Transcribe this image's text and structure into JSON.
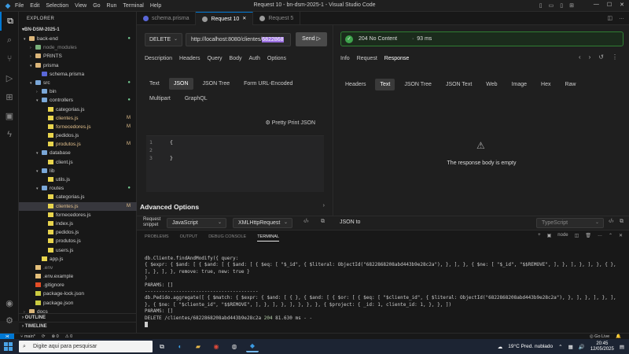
{
  "titlebar": {
    "menu": [
      "File",
      "Edit",
      "Selection",
      "View",
      "Go",
      "Run",
      "Terminal",
      "Help"
    ],
    "title": "Request 10 - bn-dsm-2025-1 - Visual Studio Code"
  },
  "sidebar": {
    "header": "EXPLORER",
    "root": "BN-DSM-2025-1",
    "tree": [
      {
        "label": "back-end",
        "kind": "folder",
        "level": 0,
        "open": true,
        "badge": "dot"
      },
      {
        "label": "node_modules",
        "kind": "folder",
        "level": 1,
        "open": false,
        "muted": true
      },
      {
        "label": "PRINTS",
        "kind": "folder",
        "level": 1,
        "open": false
      },
      {
        "label": "prisma",
        "kind": "folder",
        "level": 1,
        "open": true
      },
      {
        "label": "schema.prisma",
        "kind": "prisma",
        "level": 2
      },
      {
        "label": "src",
        "kind": "folder",
        "level": 1,
        "open": true,
        "badge": "dot"
      },
      {
        "label": "bin",
        "kind": "folder",
        "level": 2,
        "open": false
      },
      {
        "label": "controllers",
        "kind": "folder",
        "level": 2,
        "open": true,
        "badge": "dot"
      },
      {
        "label": "categorias.js",
        "kind": "js",
        "level": 3
      },
      {
        "label": "clientes.js",
        "kind": "js",
        "level": 3,
        "badge": "M",
        "modified": true
      },
      {
        "label": "fornecedores.js",
        "kind": "js",
        "level": 3,
        "badge": "M",
        "modified": true
      },
      {
        "label": "pedidos.js",
        "kind": "js",
        "level": 3
      },
      {
        "label": "produtos.js",
        "kind": "js",
        "level": 3,
        "badge": "M",
        "modified": true
      },
      {
        "label": "database",
        "kind": "folder",
        "level": 2,
        "open": true
      },
      {
        "label": "client.js",
        "kind": "js",
        "level": 3
      },
      {
        "label": "lib",
        "kind": "folder",
        "level": 2,
        "open": true
      },
      {
        "label": "utils.js",
        "kind": "js",
        "level": 3
      },
      {
        "label": "routes",
        "kind": "folder",
        "level": 2,
        "open": true,
        "badge": "dot"
      },
      {
        "label": "categorias.js",
        "kind": "js",
        "level": 3
      },
      {
        "label": "clientes.js",
        "kind": "js",
        "level": 3,
        "badge": "M",
        "modified": true,
        "selected": true
      },
      {
        "label": "fornecedores.js",
        "kind": "js",
        "level": 3
      },
      {
        "label": "index.js",
        "kind": "js",
        "level": 3
      },
      {
        "label": "pedidos.js",
        "kind": "js",
        "level": 3
      },
      {
        "label": "produtos.js",
        "kind": "js",
        "level": 3
      },
      {
        "label": "users.js",
        "kind": "js",
        "level": 3
      },
      {
        "label": "app.js",
        "kind": "js",
        "level": 2
      },
      {
        "label": ".env",
        "kind": "env",
        "level": 1,
        "muted": true
      },
      {
        "label": ".env.example",
        "kind": "env",
        "level": 1
      },
      {
        "label": ".gitignore",
        "kind": "git",
        "level": 1
      },
      {
        "label": "package-lock.json",
        "kind": "json",
        "level": 1
      },
      {
        "label": "package.json",
        "kind": "json",
        "level": 1
      },
      {
        "label": "docs",
        "kind": "folder",
        "level": 0,
        "open": false
      }
    ],
    "outline": "OUTLINE",
    "timeline": "TIMELINE"
  },
  "tabs": [
    {
      "label": "schema.prisma",
      "active": false,
      "color": "#5a67d8"
    },
    {
      "label": "Request 10",
      "active": true,
      "color": "#9a9a9a"
    },
    {
      "label": "Request 5",
      "active": false,
      "color": "#9a9a9a"
    }
  ],
  "request": {
    "method": "DELETE",
    "url_prefix": "http://localhost:8080/clientes/",
    "url_highlight": "6822868",
    "send_label": "Send",
    "tabs": [
      "Description",
      "Headers",
      "Query",
      "Body",
      "Auth",
      "Options"
    ],
    "body_types": [
      "Text",
      "JSON",
      "JSON Tree",
      "Form URL-Encoded"
    ],
    "body_types2": [
      "Multipart",
      "GraphQL"
    ],
    "active_body_type": "JSON",
    "pretty_print": "Pretty Print JSON",
    "editor_lines": [
      "{",
      "",
      "}"
    ],
    "advanced": "Advanced Options"
  },
  "response": {
    "status": "204 No Content",
    "time": "93 ms",
    "tabs": [
      "Info",
      "Request",
      "Response"
    ],
    "views": [
      "Headers",
      "Text",
      "JSON Tree",
      "JSON Text",
      "Web",
      "Image",
      "Hex",
      "Raw"
    ],
    "active_view": "Text",
    "empty_text": "The response body is empty"
  },
  "codebar": {
    "label": "Request snippet",
    "language": "JavaScript",
    "client": "XMLHttpRequest",
    "json_to": "JSON to",
    "ts": "TypeScript"
  },
  "panel": {
    "tabs": [
      "PROBLEMS",
      "OUTPUT",
      "DEBUG CONSOLE",
      "TERMINAL"
    ],
    "active": "TERMINAL",
    "shell": "node",
    "terminal_lines": [
      "db.Cliente.findAndModify({ query:",
      "{ $expr: { $and: [ { $and: [ { $and: [ { $eq: [ \"$_id\", { $literal: ObjectId(\"6822868208abd443b9e28c2a\"), }, ], }, { $ne: [ \"$_id\", \"$$REMOVE\", ], }, ], }, ], }, { }, ], }, ], }, remove: true, new: true }",
      ")",
      "PARAMS: []",
      "----------------------------------------",
      "db.Pedido.aggregate([ { $match: { $expr: { $and: [ { }, { $and: [ { $or: [ { $eq: [ \"$cliente_id\", { $literal: ObjectId(\"6822868208abd443b9e28c2a\"), }, ], }, ], }, ], }, { $ne: [ \"$cliente_id\", \"$$REMOVE\", ], }, ], }, ], }, }, }, { $project: { _id: 1, cliente_id: 1, }, }, ])",
      "PARAMS: []"
    ],
    "last_line_prefix": "DELETE /clientes/6822868208abd443b9e28c2a ",
    "last_line_status": "204",
    "last_line_suffix": " 81.630 ms - -"
  },
  "statusbar": {
    "branch": "main*",
    "errors": "⊗ 0",
    "warnings": "⚠ 0",
    "golive": "Go Live"
  },
  "taskbar": {
    "search_placeholder": "Digite aqui para pesquisar",
    "weather": "19°C  Pred. nublado",
    "time": "20:45",
    "date": "12/05/2025"
  }
}
